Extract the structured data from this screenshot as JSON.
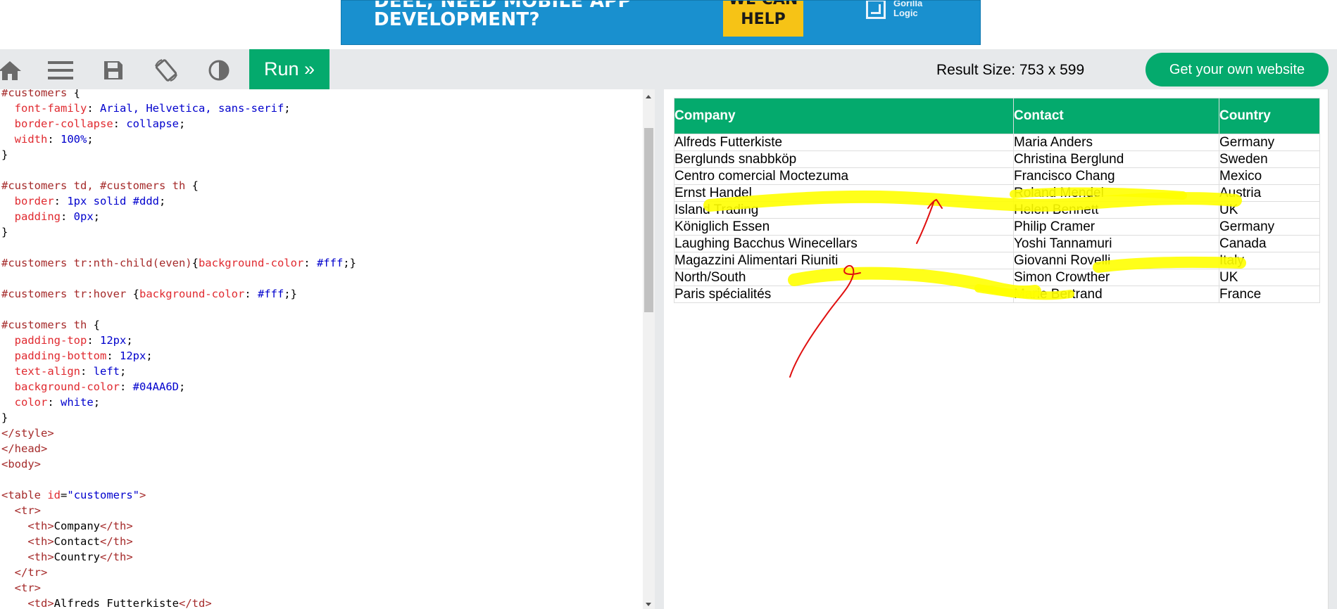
{
  "ad": {
    "line1": "DEEL, NEED MOBILE APP",
    "line2": "DEVELOPMENT?",
    "cta_line1": "WE CAN",
    "cta_line2": "HELP",
    "logo_line1": "Gorilla",
    "logo_line2": "Logic"
  },
  "toolbar": {
    "icons": [
      "home-icon",
      "menu-icon",
      "save-icon",
      "rotate-icon",
      "contrast-icon"
    ],
    "run_label": "Run »",
    "result_size": "Result Size: 753 x 599",
    "get_site_label": "Get your own website"
  },
  "code": {
    "lines": [
      "#customers {",
      "  font-family: Arial, Helvetica, sans-serif;",
      "  border-collapse: collapse;",
      "  width: 100%;",
      "}",
      "",
      "#customers td, #customers th {",
      "  border: 1px solid #ddd;",
      "  padding: 0px;",
      "}",
      "",
      "#customers tr:nth-child(even){background-color: #fff;}",
      "",
      "#customers tr:hover {background-color: #fff;}",
      "",
      "#customers th {",
      "  padding-top: 12px;",
      "  padding-bottom: 12px;",
      "  text-align: left;",
      "  background-color: #04AA6D;",
      "  color: white;",
      "}",
      "</style>",
      "</head>",
      "<body>",
      "",
      "<table id=\"customers\">",
      "  <tr>",
      "    <th>Company</th>",
      "    <th>Contact</th>",
      "    <th>Country</th>",
      "  </tr>",
      "  <tr>",
      "    <td>Alfreds Futterkiste</td>"
    ]
  },
  "table": {
    "headers": [
      "Company",
      "Contact",
      "Country"
    ],
    "rows": [
      [
        "Alfreds Futterkiste",
        "Maria Anders",
        "Germany"
      ],
      [
        "Berglunds snabbköp",
        "Christina Berglund",
        "Sweden"
      ],
      [
        "Centro comercial Moctezuma",
        "Francisco Chang",
        "Mexico"
      ],
      [
        "Ernst Handel",
        "Roland Mendel",
        "Austria"
      ],
      [
        "Island Trading",
        "Helen Bennett",
        "UK"
      ],
      [
        "Königlich Essen",
        "Philip Cramer",
        "Germany"
      ],
      [
        "Laughing Bacchus Winecellars",
        "Yoshi Tannamuri",
        "Canada"
      ],
      [
        "Magazzini Alimentari Riuniti",
        "Giovanni Rovelli",
        "Italy"
      ],
      [
        "North/South",
        "Simon Crowther",
        "UK"
      ],
      [
        "Paris spécialités",
        "Marie Bertrand",
        "France"
      ]
    ]
  },
  "colors": {
    "accent_green": "#04aa6d",
    "highlighter": "#ffff00",
    "pen": "#e01010"
  }
}
